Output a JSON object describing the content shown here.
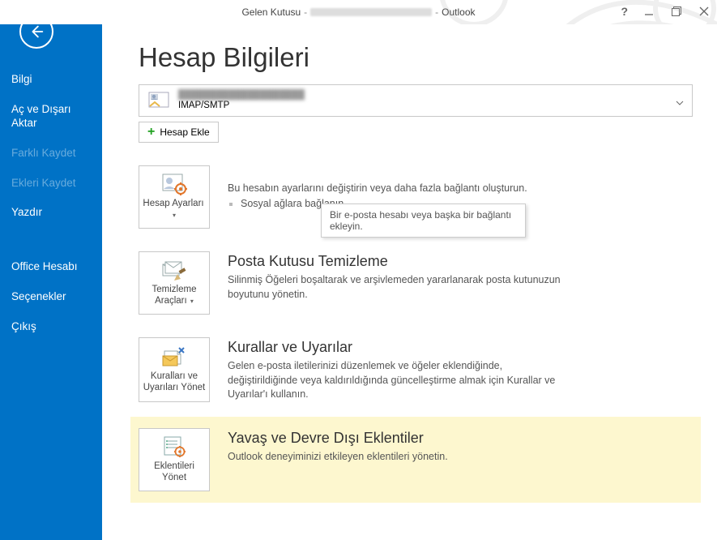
{
  "titlebar": {
    "prefix": "Gelen Kutusu",
    "suffix": "Outlook"
  },
  "sidebar": {
    "items": [
      {
        "label": "Bilgi",
        "enabled": true
      },
      {
        "label": "Aç ve Dışarı Aktar",
        "enabled": true
      },
      {
        "label": "Farklı Kaydet",
        "enabled": false
      },
      {
        "label": "Ekleri Kaydet",
        "enabled": false
      },
      {
        "label": "Yazdır",
        "enabled": true
      }
    ],
    "footerItems": [
      {
        "label": "Office Hesabı"
      },
      {
        "label": "Seçenekler"
      },
      {
        "label": "Çıkış"
      }
    ]
  },
  "page": {
    "title": "Hesap Bilgileri",
    "account": {
      "protocol": "IMAP/SMTP"
    },
    "addAccountLabel": "Hesap Ekle",
    "tooltipText": "Bir e-posta hesabı veya başka bir bağlantı ekleyin.",
    "sections": [
      {
        "button": "Hesap Ayarları",
        "hasDropdown": true,
        "description": "Bu hesabın ayarlarını değiştirin veya daha fazla bağlantı oluşturun.",
        "bullet": "Sosyal ağlara bağlanın."
      },
      {
        "button": "Temizleme Araçları",
        "hasDropdown": true,
        "title": "Posta Kutusu Temizleme",
        "description": "Silinmiş Öğeleri boşaltarak ve arşivlemeden yararlanarak posta kutunuzun boyutunu yönetin."
      },
      {
        "button": "Kuralları ve Uyarıları Yönet",
        "hasDropdown": false,
        "title": "Kurallar ve Uyarılar",
        "description": "Gelen e-posta iletilerinizi düzenlemek ve öğeler eklendiğinde, değiştirildiğinde veya kaldırıldığında güncelleştirme almak için Kurallar ve Uyarılar'ı kullanın."
      },
      {
        "button": "Eklentileri Yönet",
        "hasDropdown": false,
        "title": "Yavaş ve Devre Dışı Eklentiler",
        "description": "Outlook deneyiminizi etkileyen eklentileri yönetin.",
        "highlight": true
      }
    ]
  },
  "colors": {
    "accent": "#0072c6",
    "highlight": "#fdf7cf"
  }
}
